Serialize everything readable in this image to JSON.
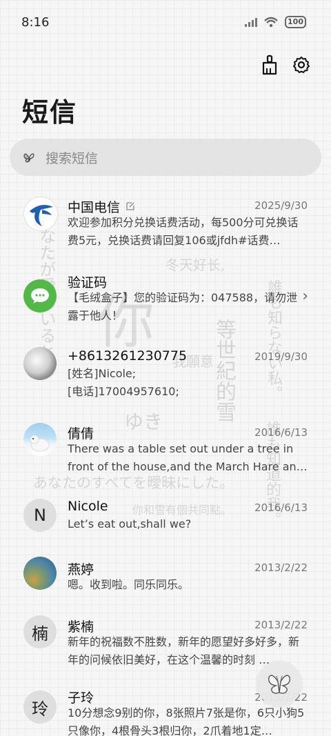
{
  "status_bar": {
    "time": "8:16",
    "battery": "100"
  },
  "header": {
    "title": "短信",
    "clean_icon": "broom-icon",
    "settings_icon": "gear-icon"
  },
  "search": {
    "placeholder": "搜索短信",
    "icon": "butterfly-search-icon"
  },
  "conversations": [
    {
      "name": "中国电信",
      "time": "2025/9/30",
      "preview": "欢迎参加积分兑换话费活动，每500分可兑换话费5元，兑换话费请回复106或jfdh#话费…",
      "avatar": "china-telecom-logo",
      "flag_icon": "edit-note-icon"
    },
    {
      "name": "验证码",
      "time": "",
      "preview": "【毛绒盒子】您的验证码为：047588，请勿泄露于他人！",
      "avatar": "message-bubble-icon",
      "has_chevron": true
    },
    {
      "name": "+8613261230775",
      "time": "2019/9/30",
      "preview_lines": [
        "[姓名]Nicole;",
        "[电话]17004957610;"
      ],
      "avatar": "photo-avatar"
    },
    {
      "name": "倩倩",
      "time": "2016/6/13",
      "preview": "There was a table set out under a tree in front of the house,and the March Hare an…",
      "avatar": "polar-bear-photo"
    },
    {
      "name": "Nicole",
      "time": "2016/6/13",
      "preview": "Let’s eat out,shall we?",
      "avatar_letter": "N"
    },
    {
      "name": "燕婷",
      "time": "2013/2/22",
      "preview": "嗯。收到啦。同乐同乐。",
      "avatar": "landscape-photo"
    },
    {
      "name": "紫楠",
      "time": "2013/2/22",
      "preview": "新年的祝福数不胜数，新年的愿望好多好多，新年的问候依旧美好，在这个温馨的时刻 …",
      "avatar_letter": "楠"
    },
    {
      "name": "子玲",
      "time": "2013/2/22",
      "preview": "10分想念9别的你，8张照片7张是你，6只小狗5只像你，4根骨头3根归你，2爪着地1定…",
      "avatar_letter": "玲"
    }
  ],
  "watermark": {
    "v1": "なたが愛しいるとを",
    "v2": "誰も知らない私。",
    "v3": "誰も知道的我。",
    "v4": "等世紀的雪",
    "h1": "冬天好长,",
    "h2": "あなたのすべてを曖昧にした。",
    "h3": "你和雪有個共同點。",
    "h4": "我願意",
    "h5": "ゆき",
    "big": "你"
  },
  "fab": {
    "icon": "butterfly-icon"
  }
}
